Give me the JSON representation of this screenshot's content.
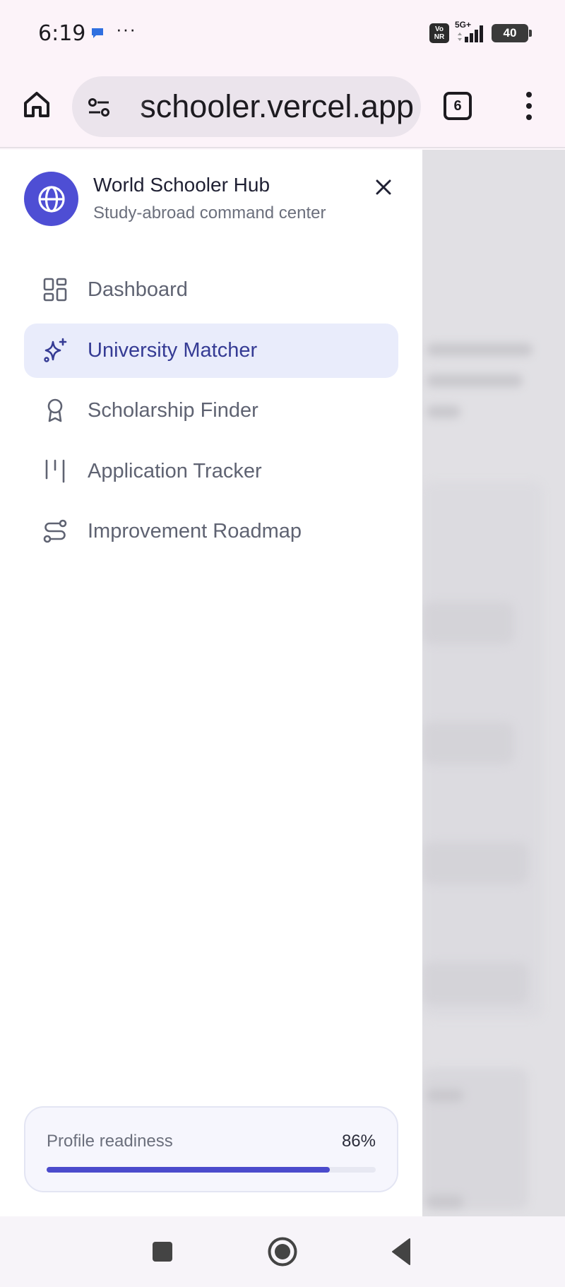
{
  "status_bar": {
    "time": "6:19",
    "more": "···",
    "network": "5G+",
    "vonr": "Vo NR",
    "battery": "40"
  },
  "browser": {
    "url": "schooler.vercel.app",
    "tab_count": "6"
  },
  "drawer": {
    "brand": {
      "title": "World Schooler Hub",
      "subtitle": "Study-abroad command center"
    },
    "nav_items": [
      {
        "label": "Dashboard",
        "icon": "dashboard-icon",
        "active": false
      },
      {
        "label": "University Matcher",
        "icon": "sparkles-icon",
        "active": true
      },
      {
        "label": "Scholarship Finder",
        "icon": "award-icon",
        "active": false
      },
      {
        "label": "Application Tracker",
        "icon": "kanban-icon",
        "active": false
      },
      {
        "label": "Improvement Roadmap",
        "icon": "route-icon",
        "active": false
      }
    ],
    "readiness": {
      "label": "Profile readiness",
      "value": "86%",
      "fraction": 0.86
    }
  },
  "colors": {
    "accent": "#4e4ed4",
    "active_bg": "#e9ecfb",
    "active_text": "#353b94"
  }
}
